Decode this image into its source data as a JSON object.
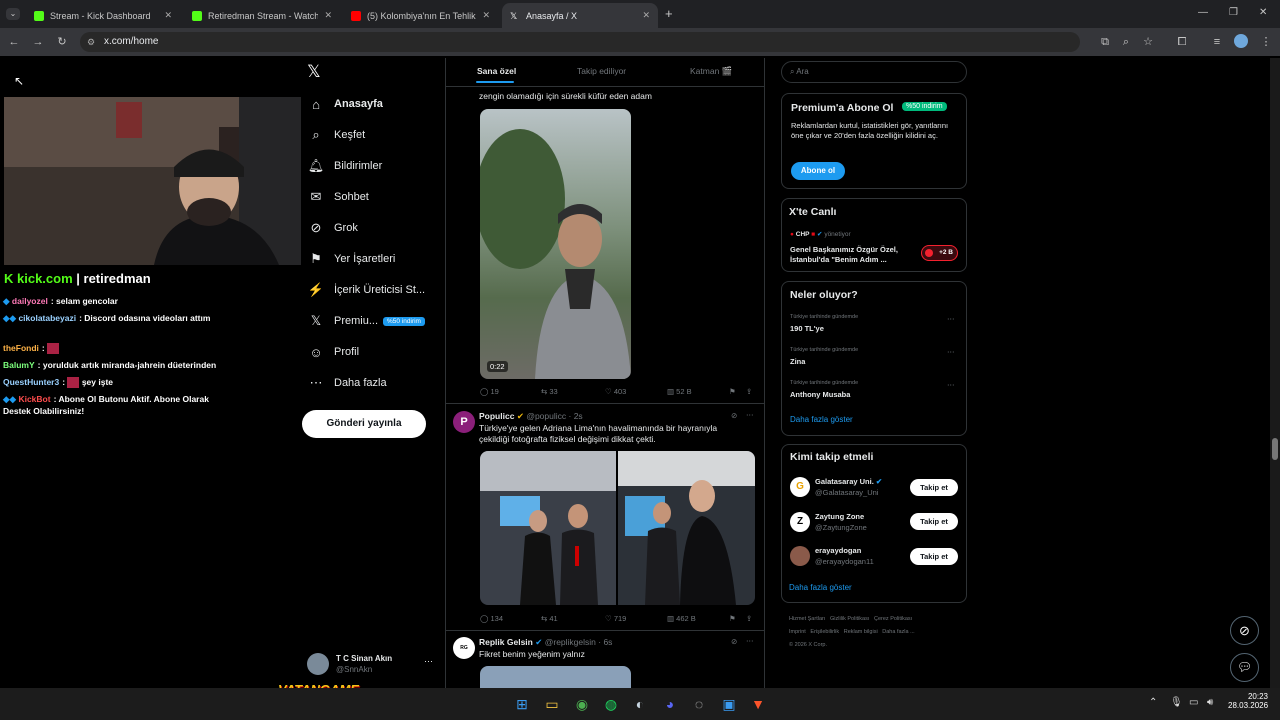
{
  "browser": {
    "tabs": [
      {
        "title": "Stream - Kick Dashboard",
        "favicon_color": "#53fc18"
      },
      {
        "title": "Retiredman Stream - Watch Live",
        "favicon_color": "#53fc18"
      },
      {
        "title": "(5) Kolombiya'nın En Tehlikeli H",
        "favicon_color": "#ff0000"
      },
      {
        "title": "Anasayfa / X",
        "favicon_color": "#ffffff"
      }
    ],
    "url": "x.com/home",
    "new_tab_icon": "plus-icon"
  },
  "overlay": {
    "kick_brand": "kick.com",
    "channel": " | retiredman",
    "chat": [
      {
        "user": "dailyozel",
        "user_color": "#ff7ab8",
        "text": ": selam gencolar"
      },
      {
        "user": "cikolatabeyazi",
        "user_color": "#9ad1ff",
        "text": ": Discord odasına videoları attım"
      },
      {
        "user": "theFondi",
        "user_color": "#ffb347",
        "text": ":"
      },
      {
        "user": "BalumY",
        "user_color": "#7dff7d",
        "text": ": yorulduk artık miranda-jahrein düeterinden"
      },
      {
        "user": "QuestHunter3",
        "user_color": "#9ad1ff",
        "text": ":"
      },
      {
        "user": "şey işte",
        "user_color": "#ffffff",
        "text": ""
      },
      {
        "user": "KickBot",
        "user_color": "#ff4d4d",
        "text": ": Abone Ol Butonu Aktif. Abone Olarak Destek Olabilirsiniz!"
      }
    ],
    "sponsor": "VATANGAME"
  },
  "x_nav": {
    "items": [
      {
        "label": "Anasayfa",
        "icon": "home-icon"
      },
      {
        "label": "Keşfet",
        "icon": "search-icon"
      },
      {
        "label": "Bildirimler",
        "icon": "bell-icon"
      },
      {
        "label": "Sohbet",
        "icon": "mail-icon"
      },
      {
        "label": "Grok",
        "icon": "grok-icon"
      },
      {
        "label": "Yer İşaretleri",
        "icon": "bookmark-icon"
      },
      {
        "label": "İçerik Üreticisi St...",
        "icon": "rocket-icon"
      },
      {
        "label": "Premiu...",
        "icon": "x-logo-icon"
      },
      {
        "label": "Profil",
        "icon": "person-icon"
      },
      {
        "label": "Daha fazla",
        "icon": "more-circle-icon"
      }
    ],
    "premium_badge": "%50 indirim",
    "post_button": "Gönderi yayınla",
    "account": {
      "name": "T C Sinan Akın",
      "handle": "@SnnAkn"
    }
  },
  "feed": {
    "tabs": [
      "Sana özel",
      "Takip ediliyor",
      "Katman 🎬"
    ],
    "post1": {
      "text": "zengin olamadığı için sürekli küfür eden adam",
      "duration": "0:22",
      "replies": "19",
      "reposts": "33",
      "likes": "403",
      "views": "52 B"
    },
    "post2": {
      "name": "Populicc",
      "handle": "@populicc",
      "time": "· 2s",
      "text": "Türkiye'ye gelen Adriana Lima'nın havalimanında bir hayranıyla çekildiği fotoğrafta fiziksel değişimi dikkat çekti.",
      "replies": "134",
      "reposts": "41",
      "likes": "719",
      "views": "462 B"
    },
    "post3": {
      "name": "Replik Gelsin",
      "handle": "@replikgelsin",
      "time": "· 6s",
      "text": "Fikret benim yeğenim yalnız"
    }
  },
  "sidebar": {
    "search_placeholder": "Ara",
    "premium": {
      "title": "Premium'a Abone Ol",
      "badge": "%50 indirim",
      "body": "Reklamlardan kurtul, istatistikleri gör, yanıtlarını öne çıkar ve 20'den fazla özelliğin kilidini aç.",
      "button": "Abone ol"
    },
    "live": {
      "title": "X'te Canlı",
      "host": "CHP",
      "status": "yönetiyor",
      "text": "Genel Başkanımız Özgür Özel, İstanbul'da \"Benim Adım ...",
      "count": "+2 B"
    },
    "trends": {
      "title": "Neler oluyor?",
      "items": [
        {
          "context": "Türkiye tarihinde gündemde",
          "name": "190 TL'ye"
        },
        {
          "context": "Türkiye tarihinde gündemde",
          "name": "Zina"
        },
        {
          "context": "Türkiye tarihinde gündemde",
          "name": "Anthony Musaba"
        }
      ],
      "more": "Daha fazla göster"
    },
    "who_to_follow": {
      "title": "Kimi takip etmeli",
      "items": [
        {
          "name": "Galatasaray Uni.",
          "handle": "@Galatasaray_Uni",
          "button": "Takip et"
        },
        {
          "name": "Zaytung Zone",
          "handle": "@ZaytungZone",
          "button": "Takip et"
        },
        {
          "name": "erayaydogan",
          "handle": "@erayaydogan11",
          "button": "Takip et"
        }
      ],
      "more": "Daha fazla göster"
    },
    "footer": [
      "Hizmet Şartları",
      "Gizlilik Politikası",
      "Çerez Politikası",
      "Imprint",
      "Erişilebilirlik",
      "Reklam bilgisi",
      "Daha fazla ...",
      "© 2026 X Corp."
    ]
  },
  "taskbar": {
    "time": "20:23",
    "date": "28.03.2026"
  }
}
